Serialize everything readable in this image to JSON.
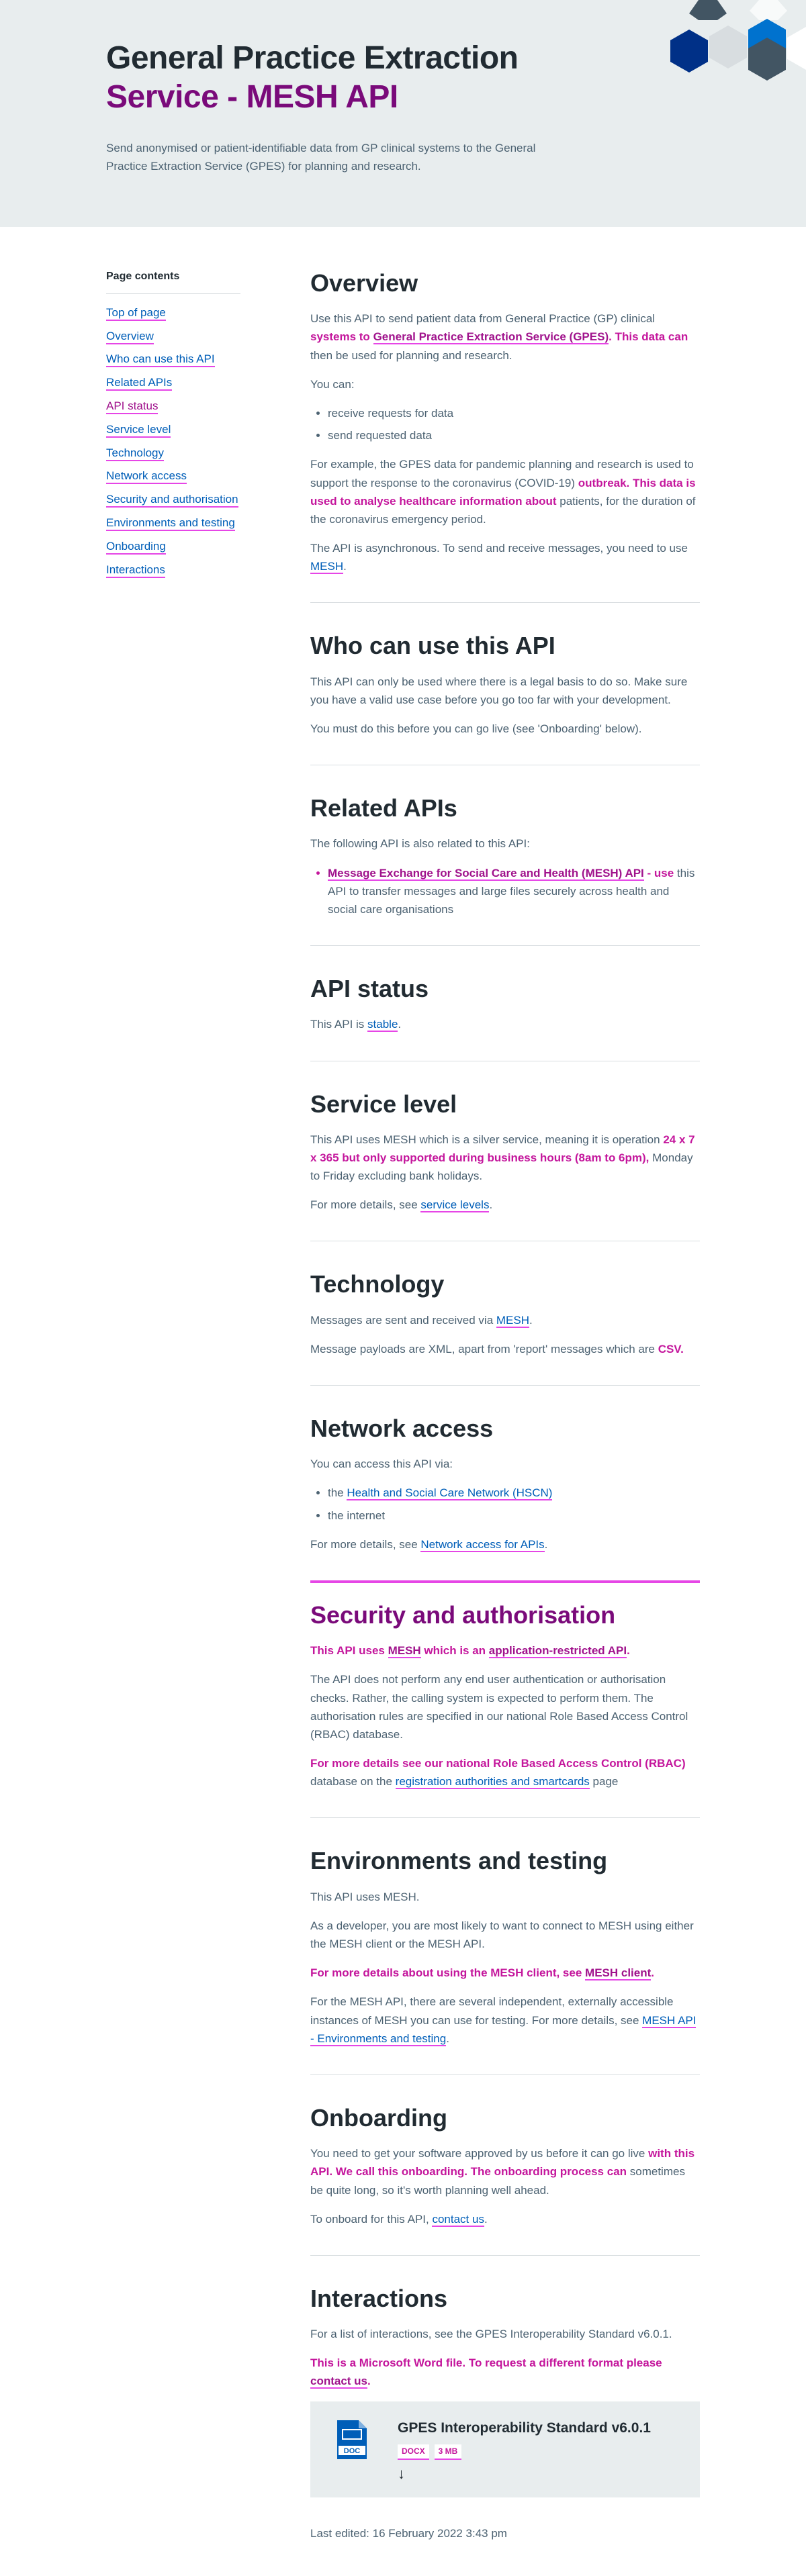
{
  "hero": {
    "title_line1": "General Practice Extraction",
    "title_line2": "Service - MESH API",
    "description": "Send anonymised or patient-identifiable data from GP clinical systems to the General Practice Extraction Service (GPES) for planning and research."
  },
  "sidebar": {
    "heading": "Page contents",
    "items": [
      {
        "label": "Top of page"
      },
      {
        "label": "Overview"
      },
      {
        "label": "Who can use this API"
      },
      {
        "label": "Related APIs"
      },
      {
        "label": "API status"
      },
      {
        "label": "Service level"
      },
      {
        "label": "Technology"
      },
      {
        "label": "Network access"
      },
      {
        "label": "Security and authorisation"
      },
      {
        "label": "Environments and testing"
      },
      {
        "label": "Onboarding"
      },
      {
        "label": "Interactions"
      }
    ]
  },
  "overview": {
    "title": "Overview",
    "p1_a": "Use this API to send patient data from General Practice (GP) clinical",
    "p1_b": "systems to",
    "p1_link": "General Practice Extraction Service (GPES)",
    "p1_c": ". This data can",
    "p1_d": "then be used for planning and research.",
    "p2": "You can:",
    "bullets": [
      "receive requests for data",
      "send requested data"
    ],
    "p3_a": "For example, the GPES data for pandemic planning and research is used to support the response to the coronavirus (COVID-19)",
    "p3_b": "outbreak. This data is used to analyse healthcare information about",
    "p3_c": "patients, for the duration of the coronavirus emergency period.",
    "p4_a": "The API is asynchronous. To send and receive messages, you need to use",
    "p4_link": "MESH",
    "p4_b": "."
  },
  "who": {
    "title": "Who can use this API",
    "p1": "This API can only be used where there is a legal basis to do so. Make sure you have a valid use case before you go too far with your development.",
    "p2": "You must do this before you can go live (see 'Onboarding' below)."
  },
  "related": {
    "title": "Related APIs",
    "p1": "The following API is also related to this API:",
    "item_link": "Message Exchange for Social Care and Health (MESH) API",
    "item_a": " - use",
    "item_b": "this API to transfer messages and large files securely across health and social care organisations"
  },
  "status": {
    "title": "API status",
    "text_a": "This API is ",
    "link": "stable",
    "text_b": "."
  },
  "service_level": {
    "title": "Service level",
    "p1_a": "This API uses MESH which is a silver service, meaning it is operation",
    "p1_b": "24 x 7 x 365 but only supported during business hours (8am to 6pm),",
    "p1_c": "Monday to Friday excluding bank holidays.",
    "p2_a": "For more details, see ",
    "p2_link": "service levels",
    "p2_b": "."
  },
  "technology": {
    "title": "Technology",
    "p1_a": "Messages are sent and received via ",
    "p1_link": "MESH",
    "p1_b": ".",
    "p2_a": "Message payloads are XML, apart from 'report' messages which are",
    "p2_b": "CSV."
  },
  "network": {
    "title": "Network access",
    "p1": "You can access this API via:",
    "bullet1_a": "the ",
    "bullet1_link": "Health and Social Care Network (HSCN)",
    "bullet2": "the internet",
    "p2_a": "For more details, see ",
    "p2_link": "Network access for APIs",
    "p2_b": "."
  },
  "security": {
    "title": "Security and authorisation",
    "p1_a": "This API uses ",
    "p1_link1": "MESH",
    "p1_b": " which is an ",
    "p1_link2": "application-restricted API",
    "p1_c": ".",
    "p2": "The API does not perform any end user authentication or authorisation checks. Rather, the calling system is expected to perform them. The authorisation rules are specified in our national Role Based Access Control (RBAC) database.",
    "p3_a": "For more details see our national Role Based Access Control (RBAC)",
    "p3_b": "database on the ",
    "p3_link": "registration authorities and smartcards",
    "p3_c": " page"
  },
  "environments": {
    "title": "Environments and testing",
    "p1": "This API uses MESH.",
    "p2": "As a developer, you are most likely to want to connect to MESH using either the MESH client or the MESH API.",
    "p3_a": "For more details about using the MESH client, see ",
    "p3_link": "MESH client",
    "p3_b": ".",
    "p4_a": "For the MESH API, there are several independent, externally accessible instances of MESH you can use for testing. For more details, see ",
    "p4_link": "MESH API - Environments and testing",
    "p4_b": "."
  },
  "onboarding": {
    "title": "Onboarding",
    "p1_a": "You need to get your software approved by us before it can go live",
    "p1_b": "with this API. We call this onboarding. The onboarding process can",
    "p1_c": "sometimes be quite long, so it's worth planning well ahead.",
    "p2_a": "To onboard for this API, ",
    "p2_link": "contact us",
    "p2_b": "."
  },
  "interactions": {
    "title": "Interactions",
    "p1": "For a list of interactions, see the GPES Interoperability Standard v6.0.1.",
    "p2_a": "This is a Microsoft Word file.  To request a different format please",
    "p2_link": "contact us",
    "p2_b": ".",
    "doc": {
      "icon_label": "DOC",
      "title": "GPES Interoperability Standard v6.0.1",
      "format": "DOCX",
      "size": "3 MB",
      "icon": "download-arrow-icon"
    }
  },
  "footer": {
    "last_edited": "Last edited: 16 February 2022 3:43 pm"
  },
  "colors": {
    "accent_magenta": "#e646e6",
    "highlight_text": "#c4169c",
    "link_blue": "#005eb8",
    "title_purple": "#7a0a7a",
    "hero_bg": "#e8edee"
  }
}
